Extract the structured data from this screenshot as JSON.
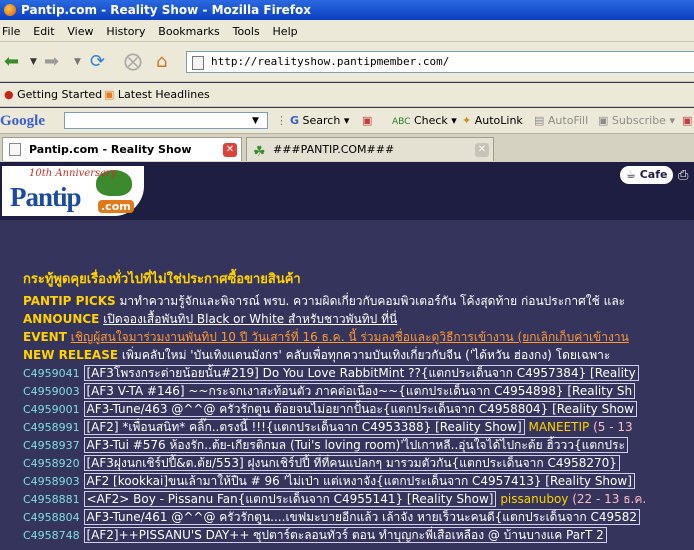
{
  "window": {
    "title": "Pantip.com - Reality Show - Mozilla Firefox"
  },
  "menu": [
    "File",
    "Edit",
    "View",
    "History",
    "Bookmarks",
    "Tools",
    "Help"
  ],
  "nav": {
    "url": "http://realityshow.pantipmember.com/"
  },
  "bookmarks": {
    "getting_started": "Getting Started",
    "latest_headlines": "Latest Headlines"
  },
  "google_toolbar": {
    "logo": "Google",
    "search_label": "Search",
    "check_label": "Check",
    "autolink_label": "AutoLink",
    "autofill_label": "AutoFill",
    "subscribe_label": "Subscribe"
  },
  "tabs": [
    {
      "label": "Pantip.com - Reality Show",
      "active": true
    },
    {
      "label": "###PANTIP.COM###",
      "active": false
    }
  ],
  "site": {
    "logo_anniversary": "10th Anniversary",
    "logo_name": "Pantip",
    "logo_com": ".com",
    "cafe": "Cafe",
    "heading": "กระทู้พูดคุยเรื่องทั่วไปที่ไม่ใช่ประกาศซื้อขายสินค้า"
  },
  "announcements": [
    {
      "label": "PANTIP PICKS",
      "text": "มาทำความรู้จักและพิจารณ์ พรบ. ความผิดเกี่ยวกับคอมพิวเตอร์กัน โค้งสุดท้าย ก่อนประกาศใช้ และ",
      "style": "txt"
    },
    {
      "label": "ANNOUNCE",
      "text": "เปิดจองเสื้อพันทิป Black or White สำหรับชาวพันทิป ที่นี่",
      "style": "lnk"
    },
    {
      "label": "EVENT",
      "text": "เชิญผู้สนใจมาร่วมงานพันทิป 10 ปี วันเสาร์ที่ 16 ธ.ค. นี้ ร่วมลงชื่อและดูวิธีการเข้างาน (ยกเลิกเก็บค่าเข้างาน",
      "style": "orange"
    },
    {
      "label": "NEW RELEASE",
      "text": "เพิ่มคลับใหม่ 'บันเทิงแดนมังกร' คลับเพื่อทุกความบันเทิงเกี่ยวกับจีน ('ได้หวัน ฮ่องกง) โดยเฉพาะ",
      "style": "txt"
    }
  ],
  "topics": [
    {
      "id": "C4959041",
      "title": "[AF3โพรงกระต่ายน้อยนั้น#219] Do You Love RabbitMint ??{แตกประเด็นจาก C4957384} [Reality",
      "poster": "",
      "meta": ""
    },
    {
      "id": "C4959003",
      "title": "[AF3 V-TA #146] ~~กระจกเงาสะท้อนตัว ภาคต่อเนื่อง~~{แตกประเด็นจาก C4954898} [Reality Sh",
      "poster": "",
      "meta": ""
    },
    {
      "id": "C4959001",
      "title": "AF3-Tune/463 @^^@ ครัวรักตูน ต้อยจนไม่อยากปั้นอะ{แตกประเด็นจาก C4958804} [Reality Show",
      "poster": "",
      "meta": ""
    },
    {
      "id": "C4958991",
      "title": "[AF2] *เพื่อนสนิท* คลิ๊ก..ตรงนี้ !!!{แตกประเด็นจาก C4953388} [Reality Show]",
      "poster": "MANEETIP",
      "meta": "(5 - 13"
    },
    {
      "id": "C4958937",
      "title": "AF3-Tui #576 ห้องรัก..ต้ย-เกียรติกมล (Tui's loving room)'ไปเกาหลี..อุ่นใจได้ไปกะต้ย ฮิ้ววว{แตกประ",
      "poster": "",
      "meta": ""
    },
    {
      "id": "C4958920",
      "title": "[AF3ฝุงนกเชิร์ปปี้&ต.ต้ย/553] ฝุงนกเชิร์ปปี้ ที่ที่คนแปลกๆ มารวมตัวกัน{แตกประเด็นจาก C4958270}",
      "poster": "",
      "meta": ""
    },
    {
      "id": "C4958903",
      "title": "AF2 [kookkai]ขนเล้ามาให้ปืน # 96 'ไม่เป่า แต่เหงาจัง{แตกประเด็นจาก C4957413} [Reality Show]",
      "poster": "",
      "meta": ""
    },
    {
      "id": "C4958881",
      "title": "<AF2> Boy - Pissanu Fan{แตกประเด็นจาก C4955141} [Reality Show]",
      "poster": "pissanuboy",
      "meta": "(22 - 13 ธ.ค."
    },
    {
      "id": "C4958804",
      "title": "AF3-Tune/461 @^^@ ครัวรักตูน....เขฟมะบายอีกแล้ว เล้าจัง หายเร็วนะคนดี{แตกประเด็นจาก C49582",
      "poster": "",
      "meta": ""
    },
    {
      "id": "C4958748",
      "title": "[AF2]++PISSANU'S DAY++ ซุปตาร์ตะลอนทัวร์ ตอน ทำบุญกะพี่เสือเหลือง @ บ้านบางแค ParT 2",
      "poster": "",
      "meta": ""
    }
  ]
}
